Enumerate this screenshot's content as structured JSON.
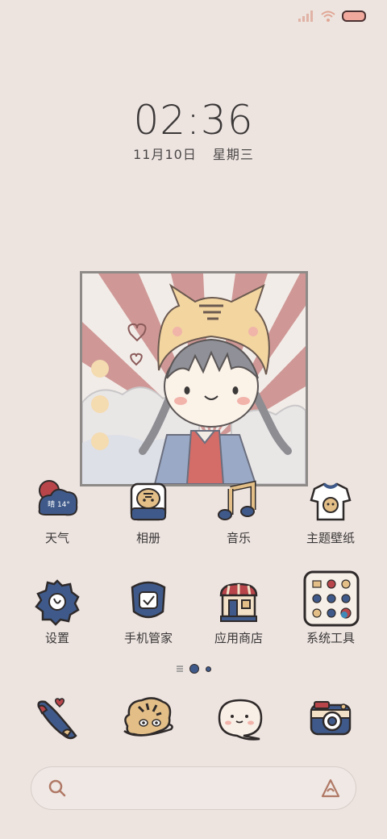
{
  "status_bar": {
    "icons": [
      "signal-icon",
      "wifi-icon",
      "battery-icon"
    ]
  },
  "clock": {
    "time": "02:36",
    "date": "11月10日",
    "weekday": "星期三"
  },
  "apps_row1": [
    {
      "label": "天气",
      "icon": "weather-icon",
      "badge": "晴 14°"
    },
    {
      "label": "相册",
      "icon": "gallery-icon"
    },
    {
      "label": "音乐",
      "icon": "music-icon"
    },
    {
      "label": "主题壁纸",
      "icon": "theme-icon"
    }
  ],
  "apps_row2": [
    {
      "label": "设置",
      "icon": "settings-icon"
    },
    {
      "label": "手机管家",
      "icon": "security-icon"
    },
    {
      "label": "应用商店",
      "icon": "store-icon"
    },
    {
      "label": "系统工具",
      "icon": "tools-folder-icon"
    }
  ],
  "dock": [
    {
      "icon": "phone-icon"
    },
    {
      "icon": "messages-icon"
    },
    {
      "icon": "chat-icon"
    },
    {
      "icon": "camera-icon"
    }
  ],
  "search_bar": {
    "left_icon": "search-icon",
    "right_icon": "assistant-icon"
  },
  "colors": {
    "background": "#ede4e0",
    "navy": "#3f5a8a",
    "accent_red": "#b8454a",
    "tan": "#e3bf87"
  }
}
